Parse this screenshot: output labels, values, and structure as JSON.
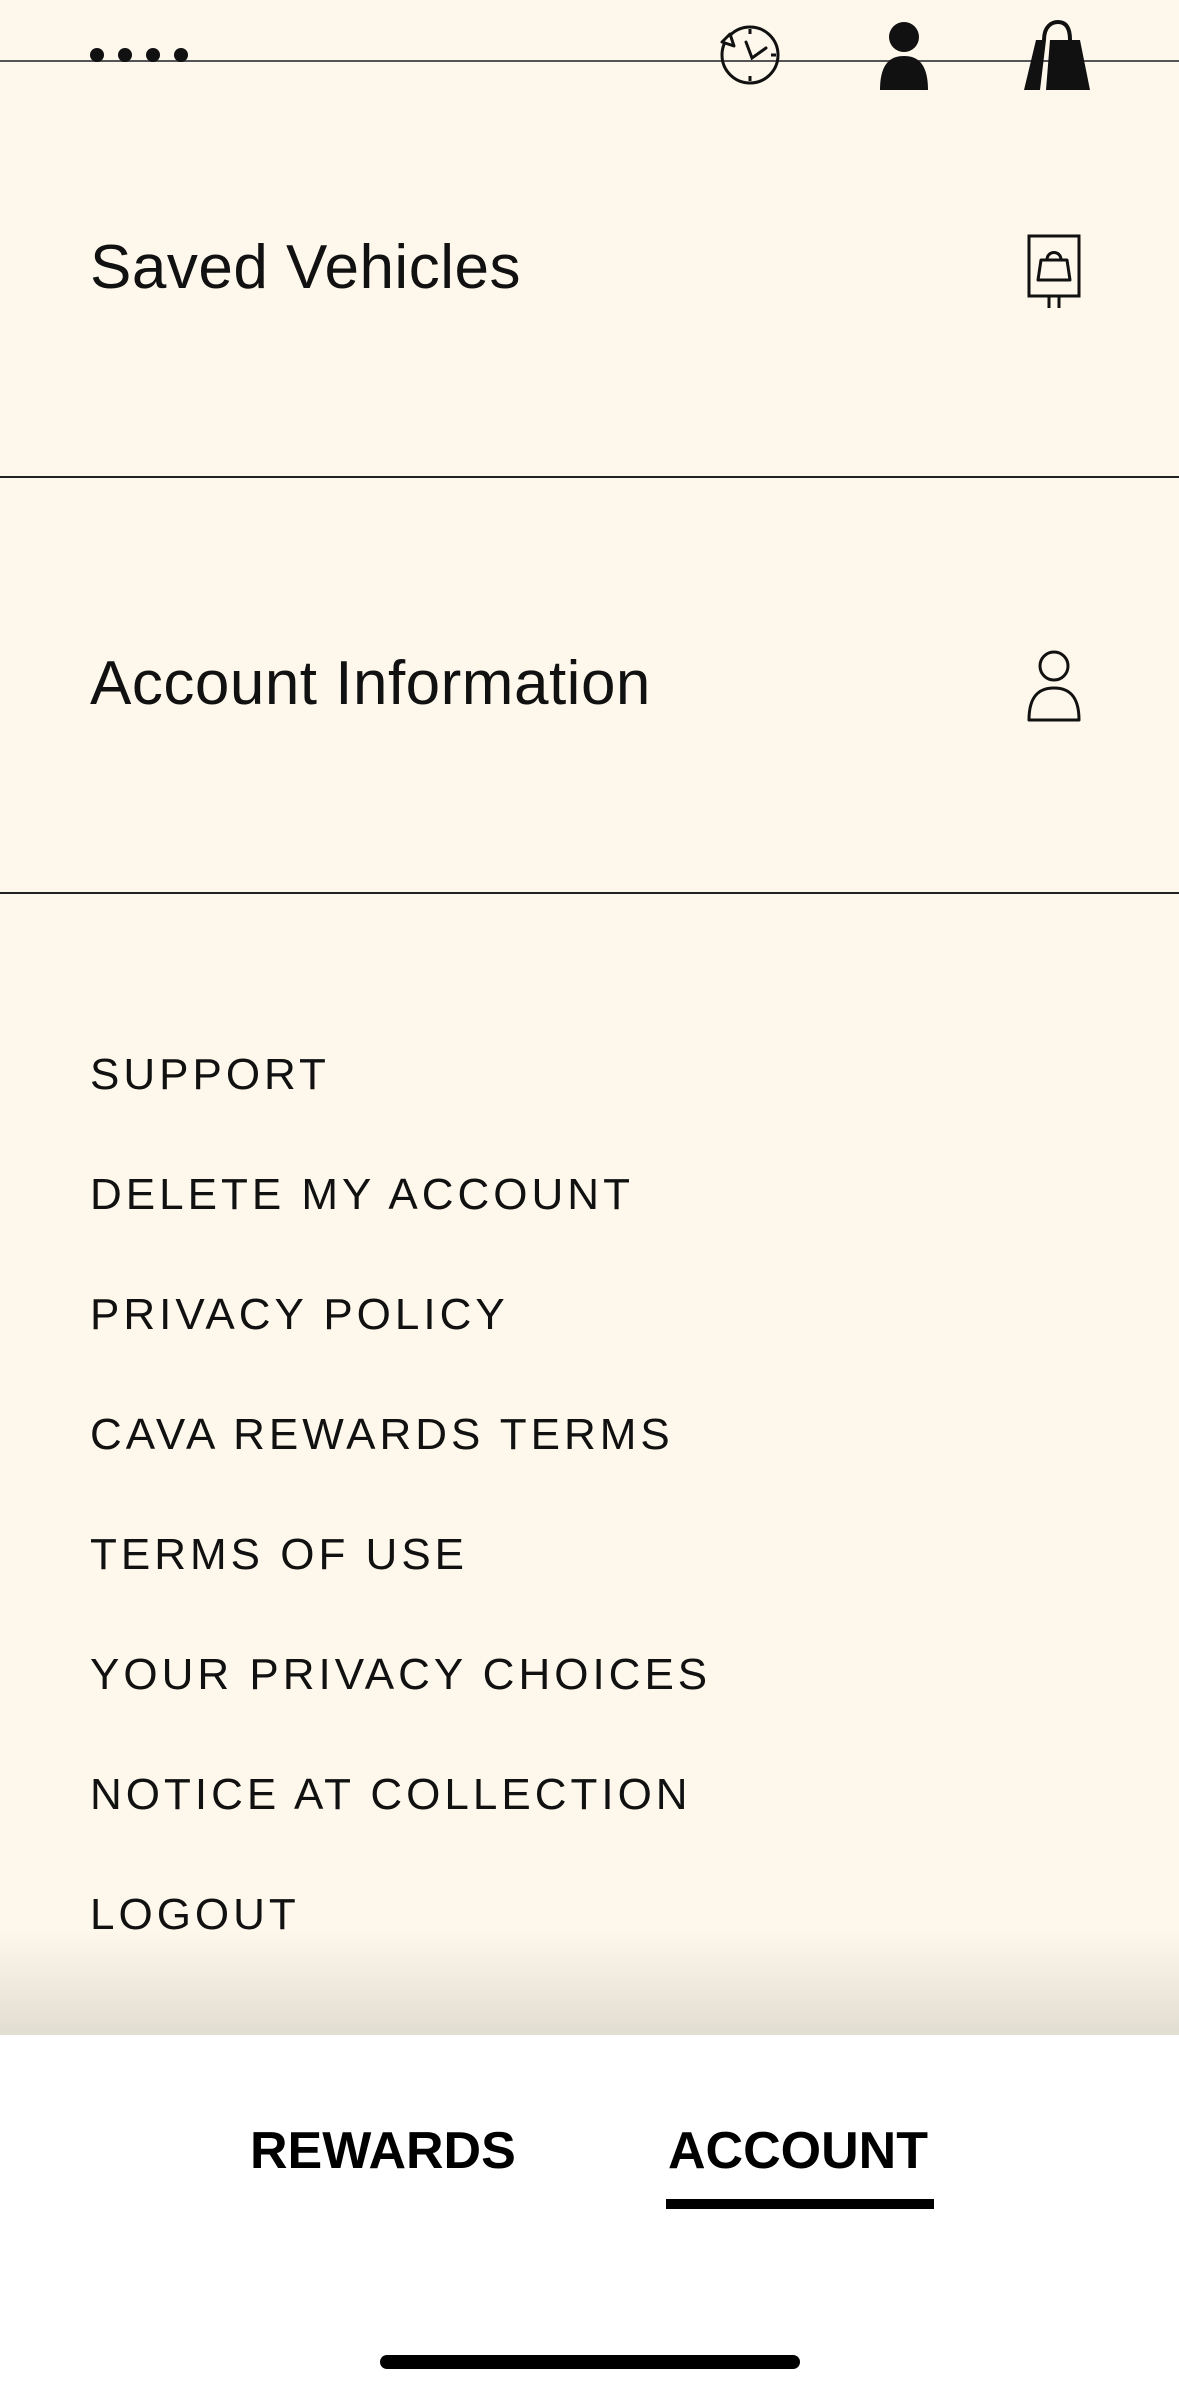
{
  "header": {
    "icons": [
      "history-icon",
      "profile-icon",
      "bag-icon"
    ]
  },
  "menu": {
    "rows": [
      {
        "label": "Saved Vehicles",
        "icon": "vehicle-icon"
      },
      {
        "label": "Account Information",
        "icon": "person-outline-icon"
      }
    ],
    "links": [
      "SUPPORT",
      "DELETE MY ACCOUNT",
      "PRIVACY POLICY",
      "CAVA REWARDS TERMS",
      "TERMS OF USE",
      "YOUR PRIVACY CHOICES",
      "NOTICE AT COLLECTION",
      "LOGOUT"
    ]
  },
  "tabs": {
    "items": [
      "REWARDS",
      "ACCOUNT"
    ],
    "active": "ACCOUNT"
  },
  "colors": {
    "background": "#fdf8eb",
    "text": "#111111",
    "tabbar": "#ffffff"
  }
}
